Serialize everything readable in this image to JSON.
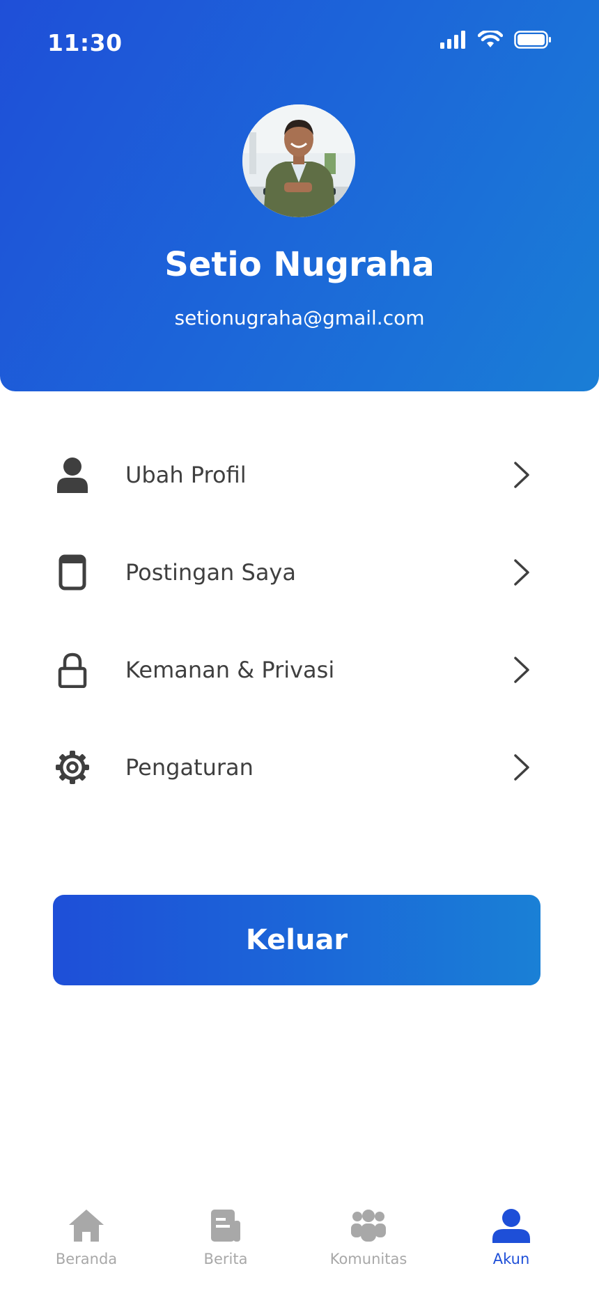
{
  "status_bar": {
    "time": "11:30"
  },
  "profile": {
    "name": "Setio Nugraha",
    "email": "setionugraha@gmail.com"
  },
  "menu": [
    {
      "label": "Ubah Profil",
      "icon": "person-icon"
    },
    {
      "label": "Postingan Saya",
      "icon": "document-icon"
    },
    {
      "label": "Kemanan & Privasi",
      "icon": "lock-icon"
    },
    {
      "label": "Pengaturan",
      "icon": "gear-icon"
    }
  ],
  "logout_label": "Keluar",
  "bottom_nav": [
    {
      "label": "Beranda",
      "icon": "home-icon",
      "active": false
    },
    {
      "label": "Berita",
      "icon": "news-icon",
      "active": false
    },
    {
      "label": "Komunitas",
      "icon": "community-icon",
      "active": false
    },
    {
      "label": "Akun",
      "icon": "account-icon",
      "active": true
    }
  ],
  "colors": {
    "primary": "#1e4fd8",
    "gradient_end": "#1a7ed6",
    "text": "#3f3f3f",
    "inactive": "#a8a8a8"
  }
}
